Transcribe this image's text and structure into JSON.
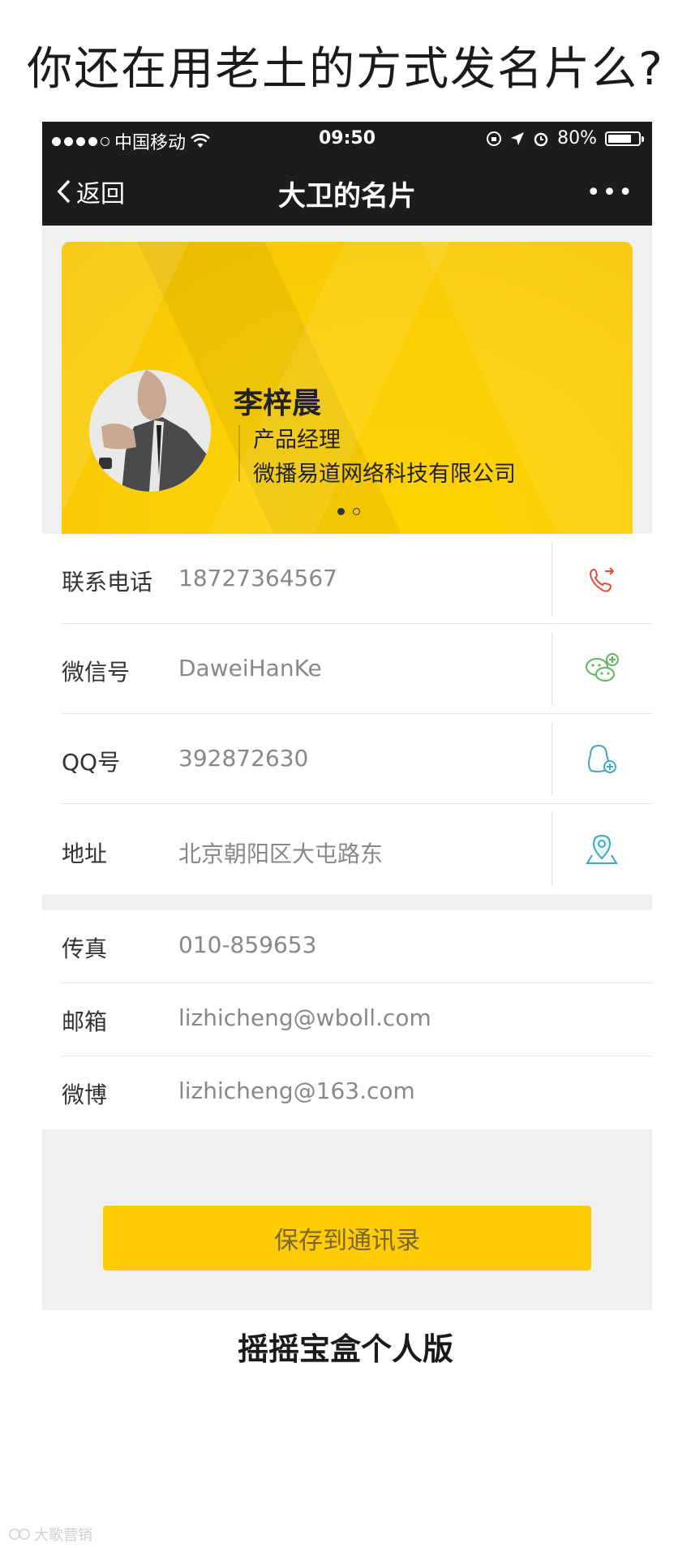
{
  "headline": "你还在用老土的方式发名片么?",
  "status_bar": {
    "carrier": "中国移动",
    "time": "09:50",
    "battery": "80%",
    "battery_level": 0.8
  },
  "nav": {
    "back_label": "返回",
    "title": "大卫的名片",
    "more_label": "•••"
  },
  "card": {
    "name": "李梓晨",
    "title": "产品经理",
    "company": "微播易道网络科技有限公司",
    "page_count": 2,
    "active_page": 1
  },
  "contact_rows": [
    {
      "label": "联系电话",
      "value": "18727364567",
      "action_icon": "phone-call-icon",
      "icon_color": "#e84a3a"
    },
    {
      "label": "微信号",
      "value": "DaweiHanKe",
      "action_icon": "wechat-add-icon",
      "icon_color": "#5cb85c"
    },
    {
      "label": "QQ号",
      "value": "392872630",
      "action_icon": "qq-add-icon",
      "icon_color": "#3aa9c6"
    },
    {
      "label": "地址",
      "value": "北京朝阳区大屯路东",
      "action_icon": "map-pin-icon",
      "icon_color": "#3aa9c6"
    }
  ],
  "info_rows": [
    {
      "label": "传真",
      "value": "010-859653"
    },
    {
      "label": "邮箱",
      "value": "lizhicheng@wboll.com"
    },
    {
      "label": "微博",
      "value": "lizhicheng@163.com"
    }
  ],
  "save_button": "保存到通讯录",
  "caption": "摇摇宝盒个人版",
  "watermark": "大歌营销"
}
